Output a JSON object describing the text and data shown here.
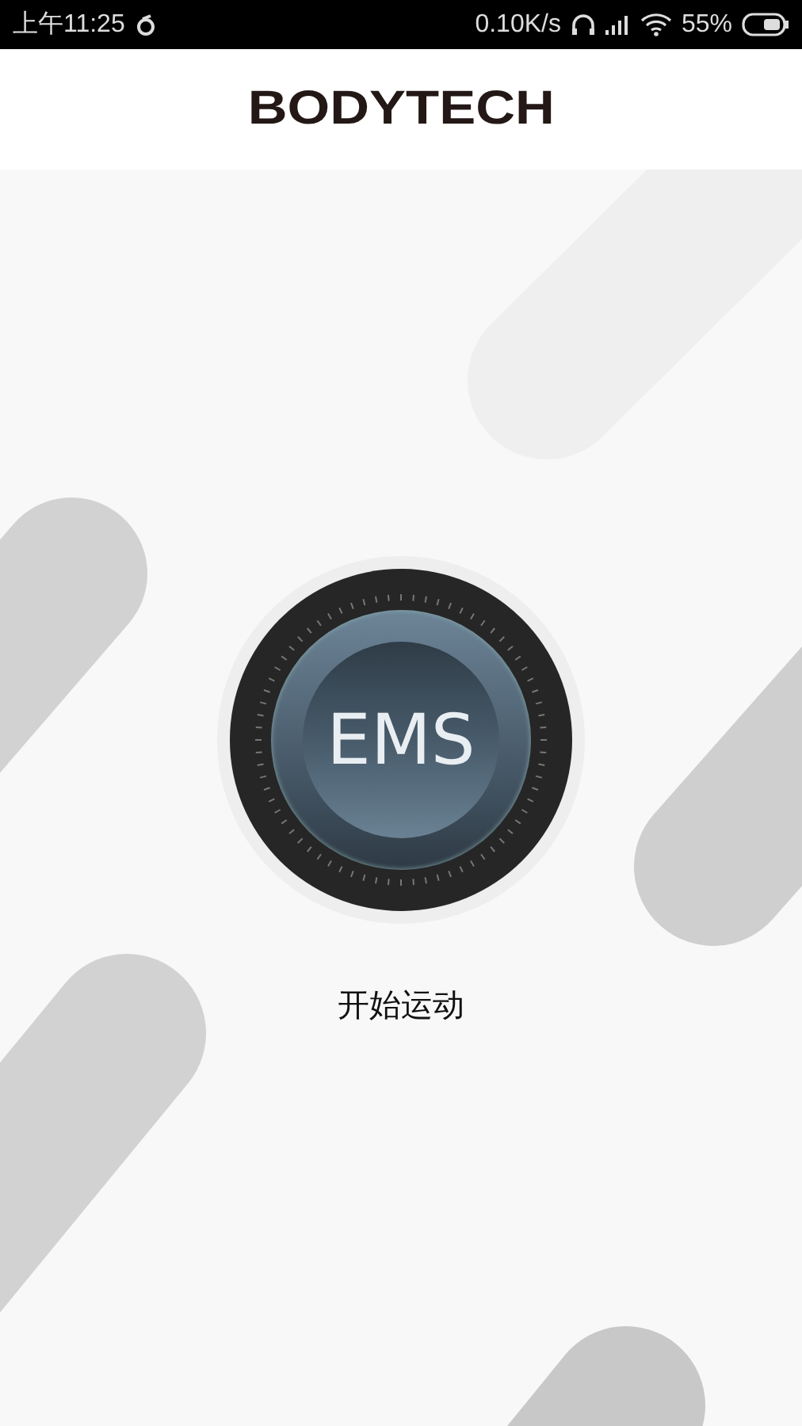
{
  "status_bar": {
    "time": "上午11:25",
    "network_speed": "0.10K/s",
    "battery": "55%"
  },
  "header": {
    "logo": "BODYTECH"
  },
  "start_button": {
    "label": "EMS"
  },
  "caption": "开始运动"
}
